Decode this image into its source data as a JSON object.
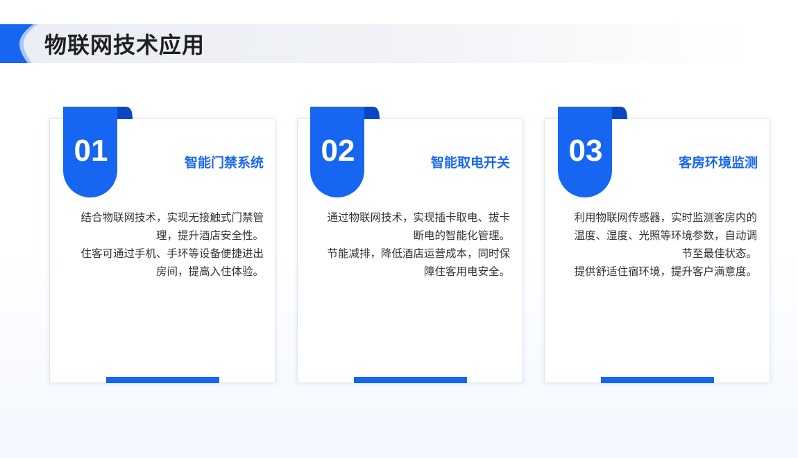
{
  "page": {
    "title": "物联网技术应用"
  },
  "colors": {
    "accent": "#1766f2",
    "accent_dark": "#0a47c2",
    "text": "#333333",
    "title": "#1f1f1f"
  },
  "cards": [
    {
      "number": "01",
      "title": "智能门禁系统",
      "paragraphs": [
        "结合物联网技术，实现无接触式门禁管理，提升酒店安全性。",
        "住客可通过手机、手环等设备便捷进出房间，提高入住体验。"
      ]
    },
    {
      "number": "02",
      "title": "智能取电开关",
      "paragraphs": [
        "通过物联网技术，实现插卡取电、拔卡断电的智能化管理。",
        "节能减排，降低酒店运营成本，同时保障住客用电安全。"
      ]
    },
    {
      "number": "03",
      "title": "客房环境监测",
      "paragraphs": [
        "利用物联网传感器，实时监测客房内的温度、湿度、光照等环境参数，自动调节至最佳状态。",
        "提供舒适住宿环境，提升客户满意度。"
      ]
    }
  ]
}
